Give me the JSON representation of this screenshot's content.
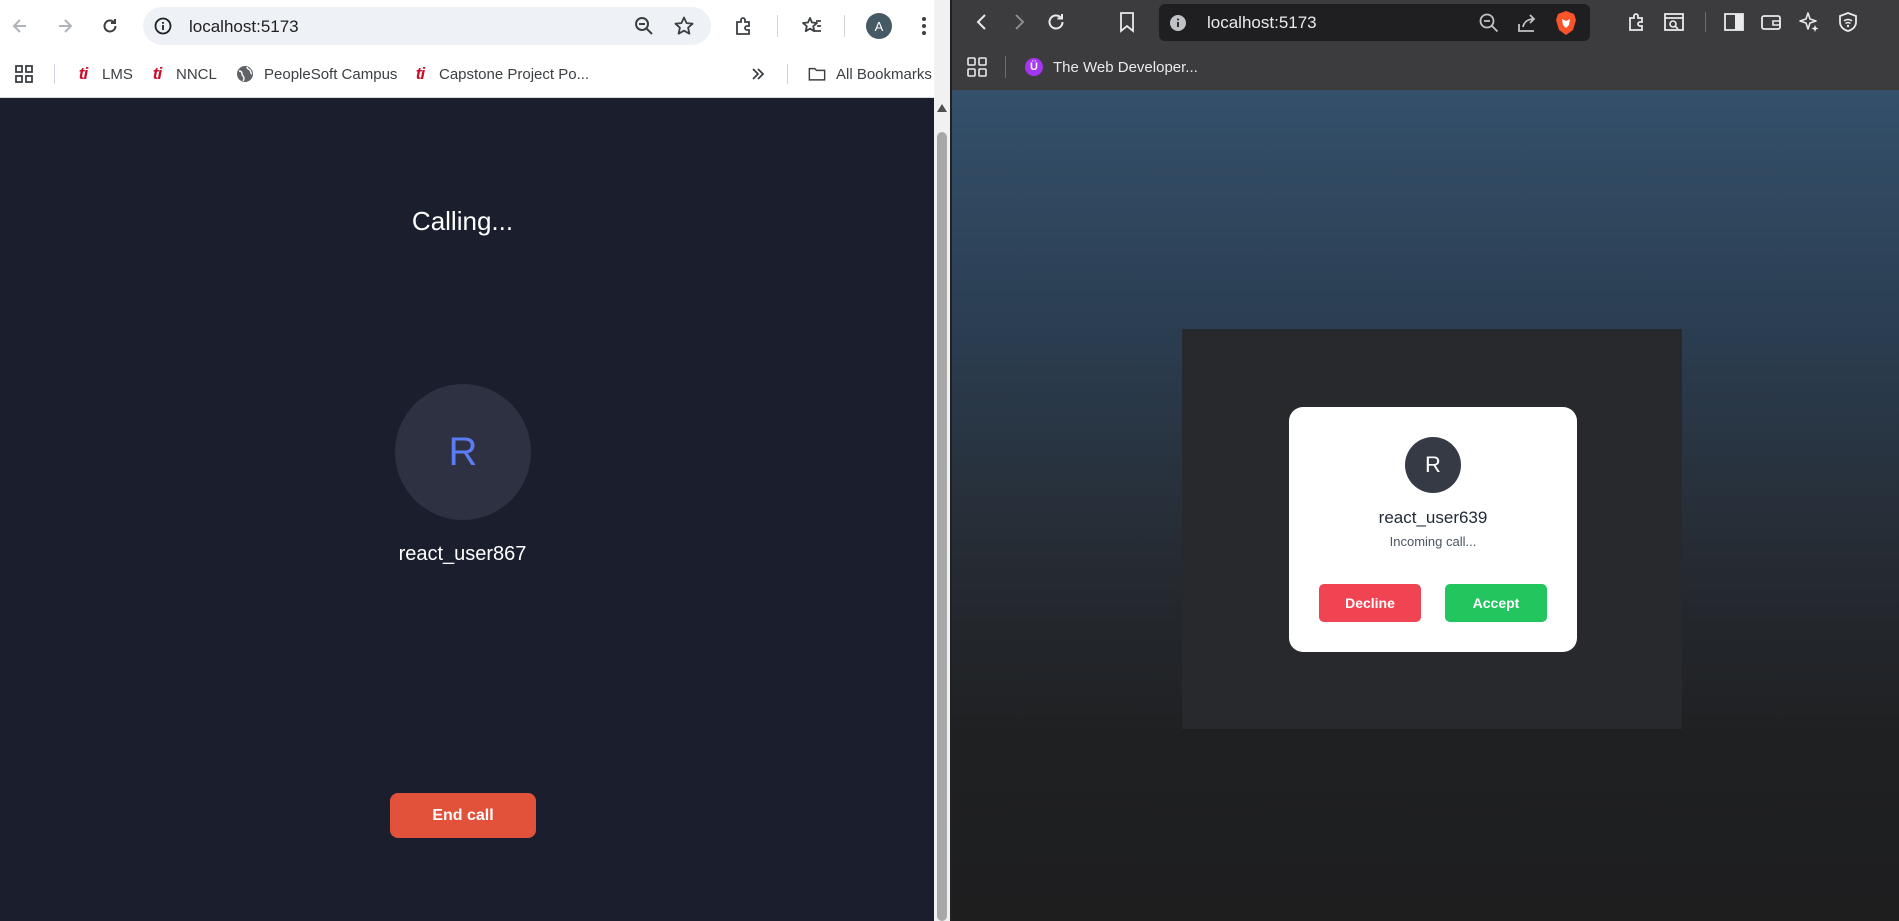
{
  "left_window": {
    "address_bar": {
      "url": "localhost:5173"
    },
    "profile": {
      "initial": "A"
    },
    "bookmarks": [
      {
        "label": "LMS",
        "icon": "ti-logo-icon"
      },
      {
        "label": "NNCL",
        "icon": "ti-logo-icon"
      },
      {
        "label": "PeopleSoft Campus",
        "icon": "globe-icon"
      },
      {
        "label": "Capstone Project Po...",
        "icon": "ti-logo-icon"
      }
    ],
    "all_bookmarks_label": "All Bookmarks",
    "favicon_text": "ti",
    "call": {
      "status": "Calling...",
      "avatar_initial": "R",
      "callee_name": "react_user867",
      "end_call_label": "End call"
    },
    "colors": {
      "background": "#1b1e2d",
      "end_call": "#e2523b",
      "avatar_letter": "#5b7cf4"
    }
  },
  "right_window": {
    "address_bar": {
      "url": "localhost:5173"
    },
    "bookmarks": [
      {
        "label": "The Web Developer...",
        "icon": "udemy-icon",
        "badge": "Ü"
      }
    ],
    "incoming_call": {
      "avatar_initial": "R",
      "caller_name": "react_user639",
      "subtitle": "Incoming call...",
      "decline_label": "Decline",
      "accept_label": "Accept"
    },
    "colors": {
      "decline": "#f04452",
      "accept": "#22c55e"
    }
  }
}
